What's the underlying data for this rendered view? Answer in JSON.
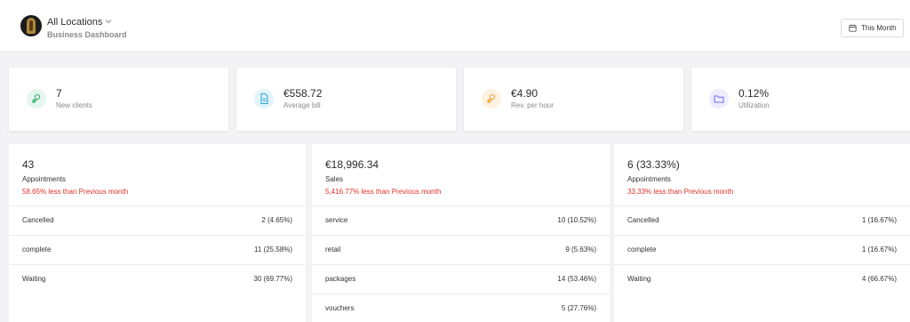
{
  "header": {
    "location_title": "All Locations",
    "subtitle": "Business Dashboard",
    "period_button": "This Month"
  },
  "kpis": [
    {
      "value": "7",
      "label": "New clients",
      "icon": "users-icon",
      "color": "#3bb273"
    },
    {
      "value": "€558.72",
      "label": "Average bill",
      "icon": "document-icon",
      "color": "#2aa7d8"
    },
    {
      "value": "€4.90",
      "label": "Rev. per hour",
      "icon": "users-icon",
      "color": "#f0a33a"
    },
    {
      "value": "0.12%",
      "label": "Utilization",
      "icon": "folder-icon",
      "color": "#7a6ff0"
    }
  ],
  "panels": [
    {
      "big": "43",
      "sub": "Appointments",
      "change": "58.65% less than Previous month",
      "rows": [
        {
          "name": "Cancelled",
          "value": "2 (4.65%)"
        },
        {
          "name": "complete",
          "value": "11 (25.58%)"
        },
        {
          "name": "Waiting",
          "value": "30 (69.77%)"
        }
      ]
    },
    {
      "big": "€18,996.34",
      "sub": "Sales",
      "change": "5,416.77% less than Previous month",
      "rows": [
        {
          "name": "service",
          "value": "10 (10.52%)"
        },
        {
          "name": "retail",
          "value": "9 (5.63%)"
        },
        {
          "name": "packages",
          "value": "14 (53.46%)"
        },
        {
          "name": "vouchers",
          "value": "5 (27.76%)"
        }
      ]
    },
    {
      "big": "6 (33.33%)",
      "sub": "Appointments",
      "change": "33.33% less than Previous month",
      "rows": [
        {
          "name": "Cancelled",
          "value": "1 (16.67%)"
        },
        {
          "name": "complete",
          "value": "1 (16.67%)"
        },
        {
          "name": "Waiting",
          "value": "4 (66.67%)"
        }
      ]
    }
  ]
}
